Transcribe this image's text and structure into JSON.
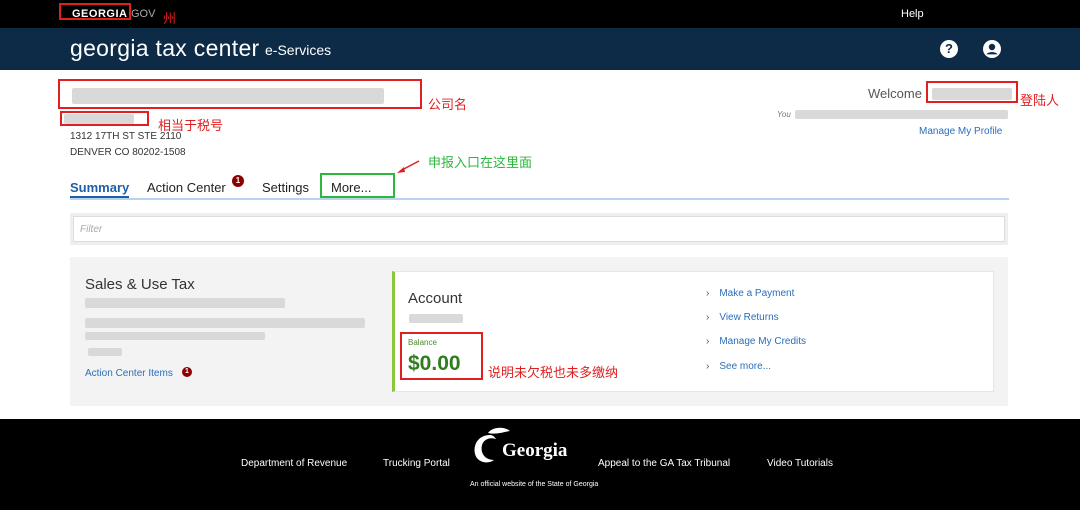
{
  "topbar": {
    "brand": "GEORGIA",
    "gov": "GOV",
    "help": "Help",
    "annotation_state": "州"
  },
  "header": {
    "title": "georgia tax center",
    "subtitle": "e-Services"
  },
  "profile": {
    "annotation_company": "公司名",
    "annotation_taxid": "相当于税号",
    "address_line1": "1312 17TH ST STE 2110",
    "address_line2": "DENVER CO 80202-1508",
    "welcome": "Welcome",
    "annotation_login": "登陆人",
    "you_prefix": "You",
    "manage_profile": "Manage My Profile"
  },
  "tabs": {
    "summary": "Summary",
    "action_center": "Action Center",
    "action_center_badge": "1",
    "settings": "Settings",
    "more": "More...",
    "annotation_more": "申报入口在这里面"
  },
  "filter": {
    "placeholder": "Filter"
  },
  "account_card": {
    "tax_type": "Sales & Use Tax",
    "action_center_items": "Action Center Items",
    "action_center_items_badge": "1",
    "account_title": "Account",
    "balance_label": "Balance",
    "balance_value": "$0.00",
    "annotation_balance": "说明未欠税也未多缴纳",
    "quick_links": [
      "Make a Payment",
      "View Returns",
      "Manage My Credits",
      "See more..."
    ]
  },
  "footer": {
    "links": [
      "Department of Revenue",
      "Trucking Portal",
      "Appeal to the GA Tax Tribunal",
      "Video Tutorials"
    ],
    "logo_text": "Georgia",
    "official": "An official website of the State of Georgia"
  },
  "colors": {
    "header_bg": "#0d2a47",
    "link_blue": "#2a6ebb",
    "balance_green": "#2e7d1f",
    "annotation_red": "#e02020",
    "annotation_green": "#2db83d"
  }
}
